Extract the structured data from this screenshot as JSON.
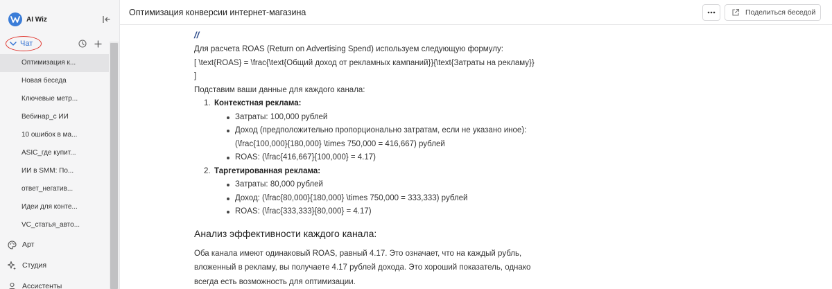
{
  "app": {
    "name": "AI Wiz"
  },
  "colors": {
    "accent": "#3b7dd8",
    "annotation": "#e0342c",
    "link": "#2f6fd1"
  },
  "sidebar": {
    "chat_label": "Чат",
    "history": [
      "Оптимизация к...",
      "Новая беседа",
      "Ключевые метр...",
      "Вебинар_с ИИ",
      "10 ошибок в ма...",
      "ASIC_где купит...",
      "ИИ в SMM: По...",
      "ответ_негатив...",
      "Идеи для конте...",
      "VC_статья_авто..."
    ],
    "nav": [
      {
        "label": "Арт",
        "icon": "palette-icon"
      },
      {
        "label": "Студия",
        "icon": "sparkle-icon"
      },
      {
        "label": "Ассистенты",
        "icon": "assistants-icon"
      }
    ]
  },
  "header": {
    "title": "Оптимизация конверсии интернет-магазина",
    "more_label": "•••",
    "share_label": "Поделиться беседой"
  },
  "content": {
    "marker": "//",
    "intro": "Для расчета ROAS (Return on Advertising Spend) используем следующую формулу:",
    "formula_line1": "[ \\text{ROAS} = \\frac{\\text{Общий доход от рекламных кампаний}}{\\text{Затраты на рекламу}}",
    "formula_line2": "]",
    "substitute": "Подставим ваши данные для каждого канала:",
    "channels": [
      {
        "num": "1.",
        "name": "Контекстная реклама:",
        "bullets": [
          {
            "text": "Затраты: 100,000 рублей"
          },
          {
            "text": "Доход (предположительно пропорционально затратам, если не указано иное):",
            "cont": "(\\frac{100,000}{180,000} \\times 750,000 = 416,667) рублей"
          },
          {
            "text": "ROAS: (\\frac{416,667}{100,000} = 4.17)"
          }
        ]
      },
      {
        "num": "2.",
        "name": "Таргетированная реклама:",
        "bullets": [
          {
            "text": "Затраты: 80,000 рублей"
          },
          {
            "text": "Доход: (\\frac{80,000}{180,000} \\times 750,000 = 333,333) рублей"
          },
          {
            "text": "ROAS: (\\frac{333,333}{80,000} = 4.17)"
          }
        ]
      }
    ],
    "analysis_title": "Анализ эффективности каждого канала:",
    "analysis_lines": [
      "Оба канала имеют одинаковый ROAS, равный 4.17. Это означает, что на каждый рубль,",
      "вложенный в рекламу, вы получаете 4.17 рублей дохода. Это хороший показатель, однако",
      "всегда есть возможность для оптимизации."
    ]
  }
}
